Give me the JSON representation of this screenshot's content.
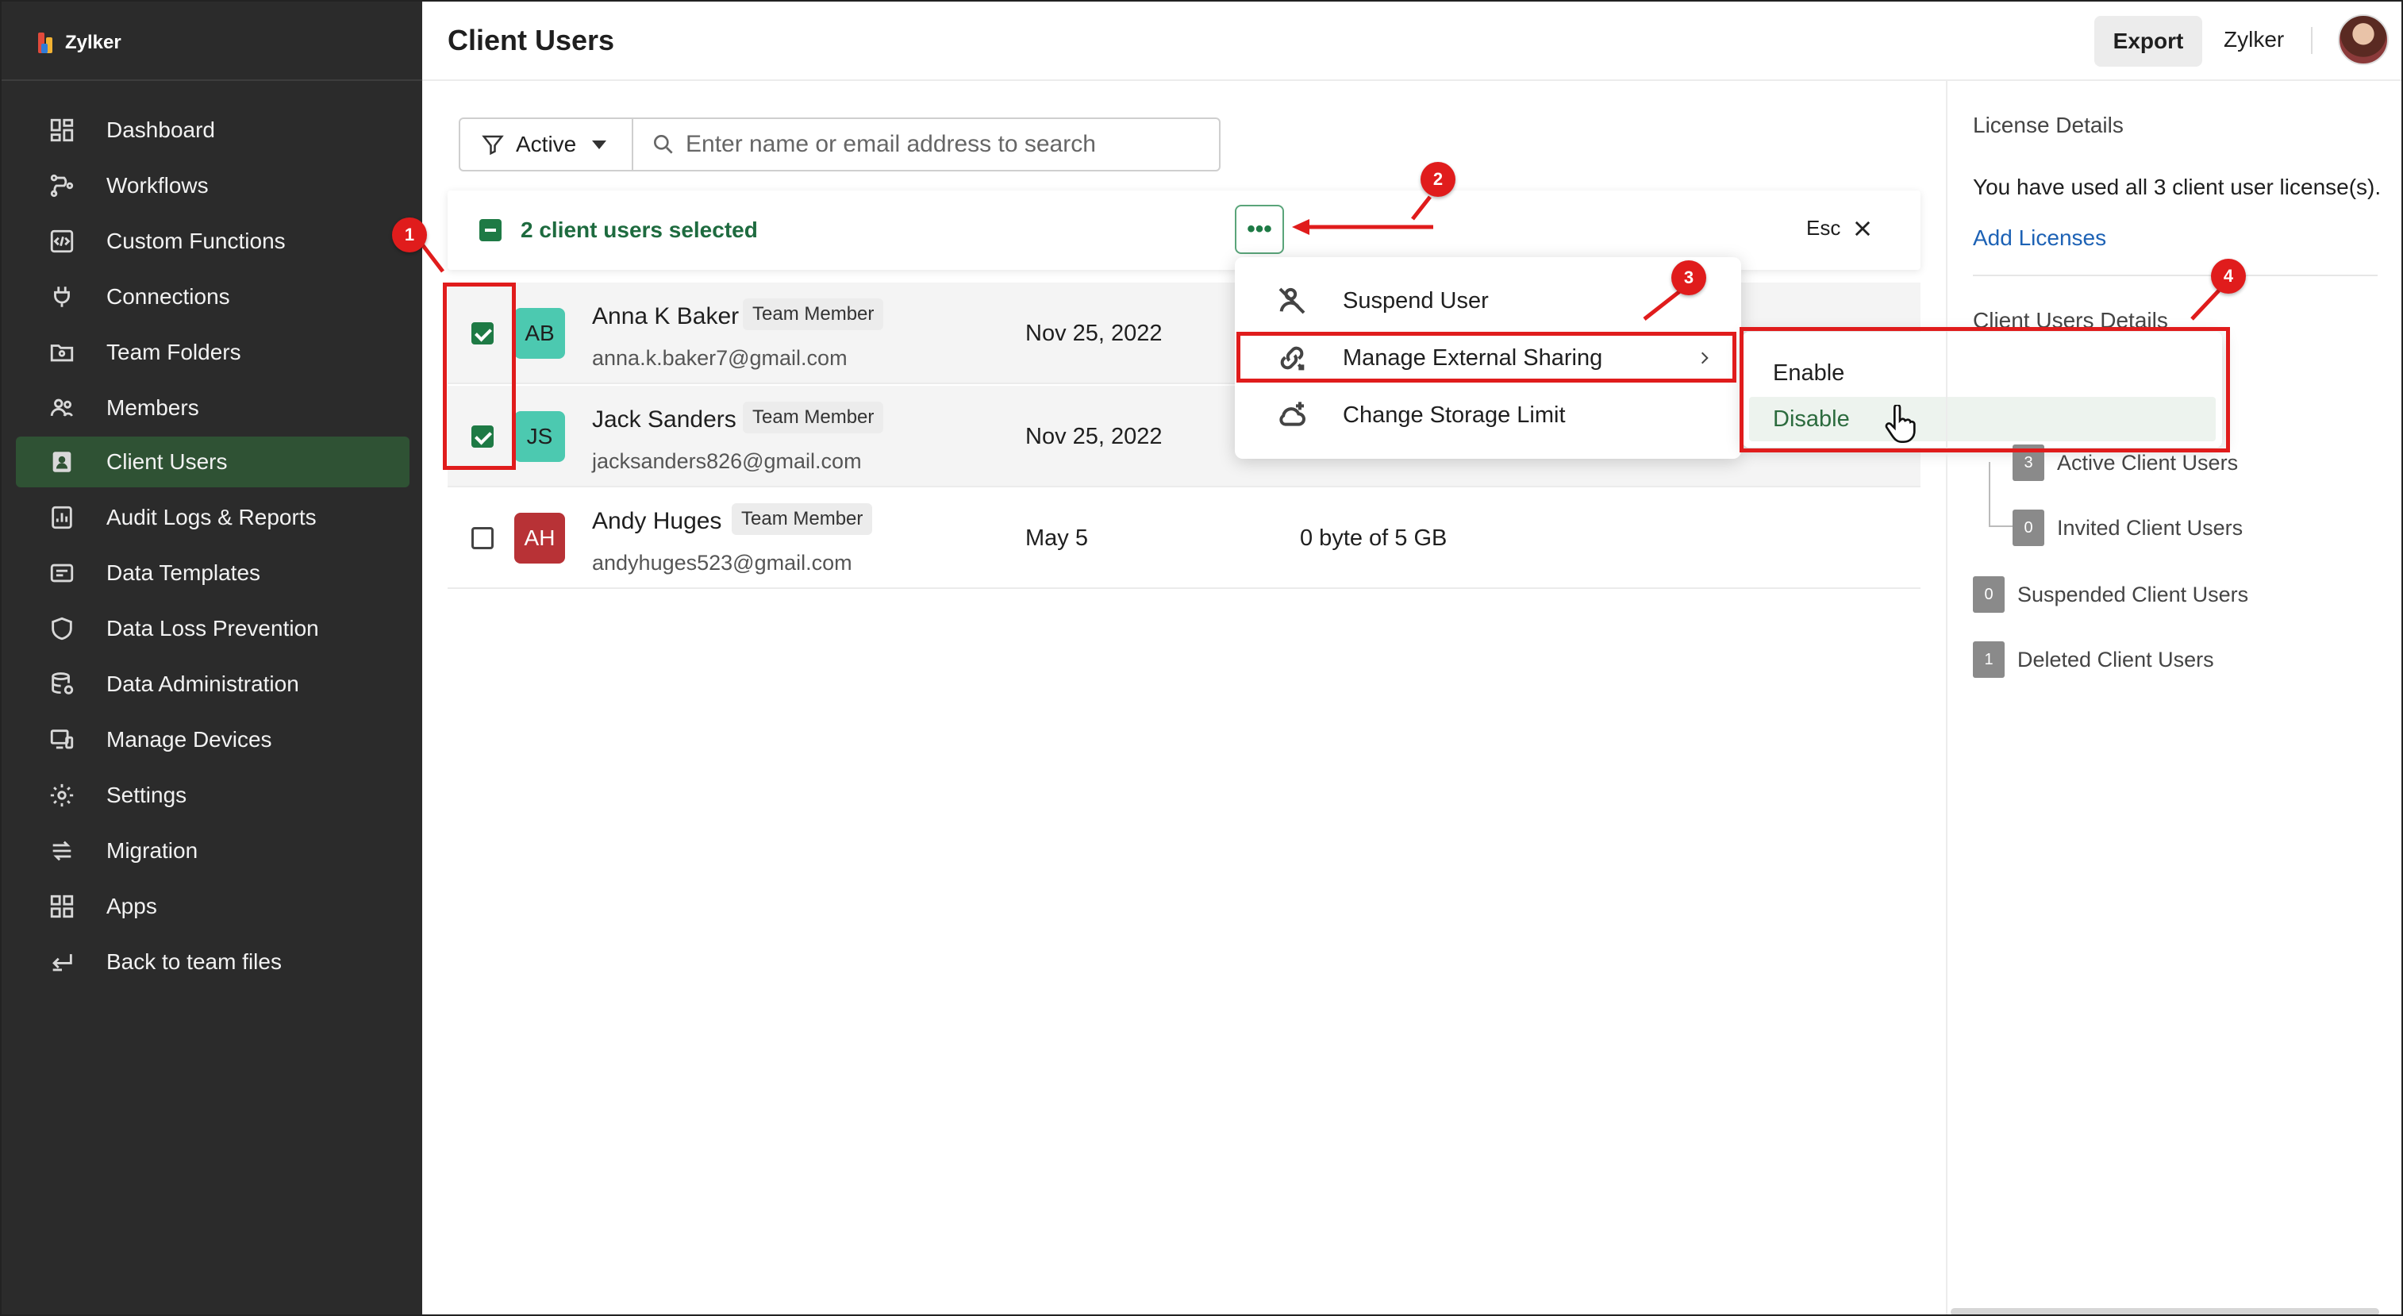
{
  "app": {
    "name": "Zylker",
    "page_title": "Client Users"
  },
  "sidebar": {
    "items": [
      {
        "label": "Dashboard",
        "icon": "dashboard-icon"
      },
      {
        "label": "Workflows",
        "icon": "workflow-icon"
      },
      {
        "label": "Custom Functions",
        "icon": "code-icon"
      },
      {
        "label": "Connections",
        "icon": "plug-icon"
      },
      {
        "label": "Team Folders",
        "icon": "folder-icon"
      },
      {
        "label": "Members",
        "icon": "members-icon"
      },
      {
        "label": "Client Users",
        "icon": "client-user-icon",
        "active": true
      },
      {
        "label": "Audit Logs & Reports",
        "icon": "report-icon"
      },
      {
        "label": "Data Templates",
        "icon": "template-icon"
      },
      {
        "label": "Data Loss Prevention",
        "icon": "shield-icon"
      },
      {
        "label": "Data Administration",
        "icon": "database-icon"
      },
      {
        "label": "Manage Devices",
        "icon": "devices-icon"
      },
      {
        "label": "Settings",
        "icon": "gear-icon"
      },
      {
        "label": "Migration",
        "icon": "migration-icon"
      },
      {
        "label": "Apps",
        "icon": "apps-icon"
      },
      {
        "label": "Back to team files",
        "icon": "back-icon"
      }
    ]
  },
  "header": {
    "export_label": "Export",
    "org_name": "Zylker"
  },
  "filter": {
    "label": "Active",
    "search_placeholder": "Enter name or email address to search"
  },
  "selection": {
    "text": "2 client users selected",
    "more_label": "•••",
    "esc_label": "Esc"
  },
  "users": [
    {
      "initials": "AB",
      "name": "Anna K Baker",
      "role": "Team Member",
      "email": "anna.k.baker7@gmail.com",
      "date": "Nov 25, 2022",
      "storage": "",
      "selected": true,
      "avatar_bg": "#4cc9b0",
      "avatar_fg": "#1f1f1f"
    },
    {
      "initials": "JS",
      "name": "Jack Sanders",
      "role": "Team Member",
      "email": "jacksanders826@gmail.com",
      "date": "Nov 25, 2022",
      "storage": "",
      "selected": true,
      "avatar_bg": "#4cc9b0",
      "avatar_fg": "#1f1f1f"
    },
    {
      "initials": "AH",
      "name": "Andy Huges",
      "role": "Team Member",
      "email": "andyhuges523@gmail.com",
      "date": "May 5",
      "storage": "0 byte of 5 GB",
      "selected": false,
      "avatar_bg": "#b83236",
      "avatar_fg": "#ffffff"
    }
  ],
  "context_menu": {
    "items": [
      {
        "label": "Suspend User",
        "icon": "suspend-user-icon"
      },
      {
        "label": "Manage External Sharing",
        "icon": "external-share-icon",
        "has_submenu": true
      },
      {
        "label": "Change Storage Limit",
        "icon": "cloud-plus-icon"
      }
    ]
  },
  "submenu": {
    "items": [
      {
        "label": "Enable"
      },
      {
        "label": "Disable",
        "hovered": true
      }
    ]
  },
  "right_panel": {
    "license_heading": "License Details",
    "license_text": "You have used all 3 client user license(s).",
    "add_licenses": "Add Licenses",
    "client_users_heading": "Client Users Details",
    "stats": [
      {
        "count": "3",
        "label": "Active Client Users"
      },
      {
        "count": "0",
        "label": "Invited Client Users"
      },
      {
        "count": "0",
        "label": "Suspended Client Users"
      },
      {
        "count": "1",
        "label": "Deleted Client Users"
      }
    ]
  },
  "annotations": {
    "badges": [
      "1",
      "2",
      "3",
      "4"
    ],
    "accent_color": "#e01c1c"
  },
  "colors": {
    "sidebar_bg": "#2b2b2b",
    "sidebar_active": "#2f5234",
    "brand_green": "#1e7a45",
    "link_blue": "#1d62b5"
  }
}
